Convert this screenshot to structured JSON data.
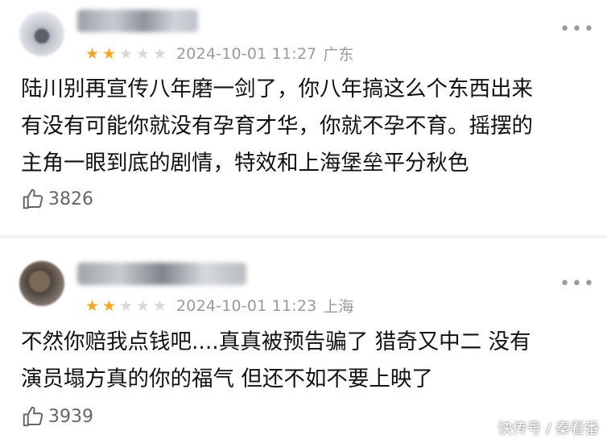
{
  "comments": [
    {
      "rating_stars": 2,
      "rating_max": 5,
      "timestamp": "2024-10-01 11:27",
      "region": "广东",
      "content_lines": [
        "陆川别再宣传八年磨一剑了，你八年搞这么个东西出来",
        "有没有可能你就没有孕育才华，你就不孕不育。摇摆的",
        "主角一眼到底的剧情，特效和上海堡垒平分秋色"
      ],
      "likes": "3826"
    },
    {
      "rating_stars": 2,
      "rating_max": 5,
      "timestamp": "2024-10-01 11:23",
      "region": "上海",
      "content_lines": [
        "不然你赔我点钱吧....真真被预告骗了 猎奇又中二 没有",
        "演员塌方真的你的福气 但还不如不要上映了"
      ],
      "likes": "3939"
    }
  ],
  "colors": {
    "star_on": "#f6a623",
    "star_off": "#d9d9d9",
    "meta_text": "#9a9a9a",
    "like_text": "#666666"
  },
  "icons": {
    "more": "more-dots-icon",
    "like": "thumbs-up-icon",
    "star": "star-icon"
  },
  "watermark": "快传号 / 秦看番"
}
